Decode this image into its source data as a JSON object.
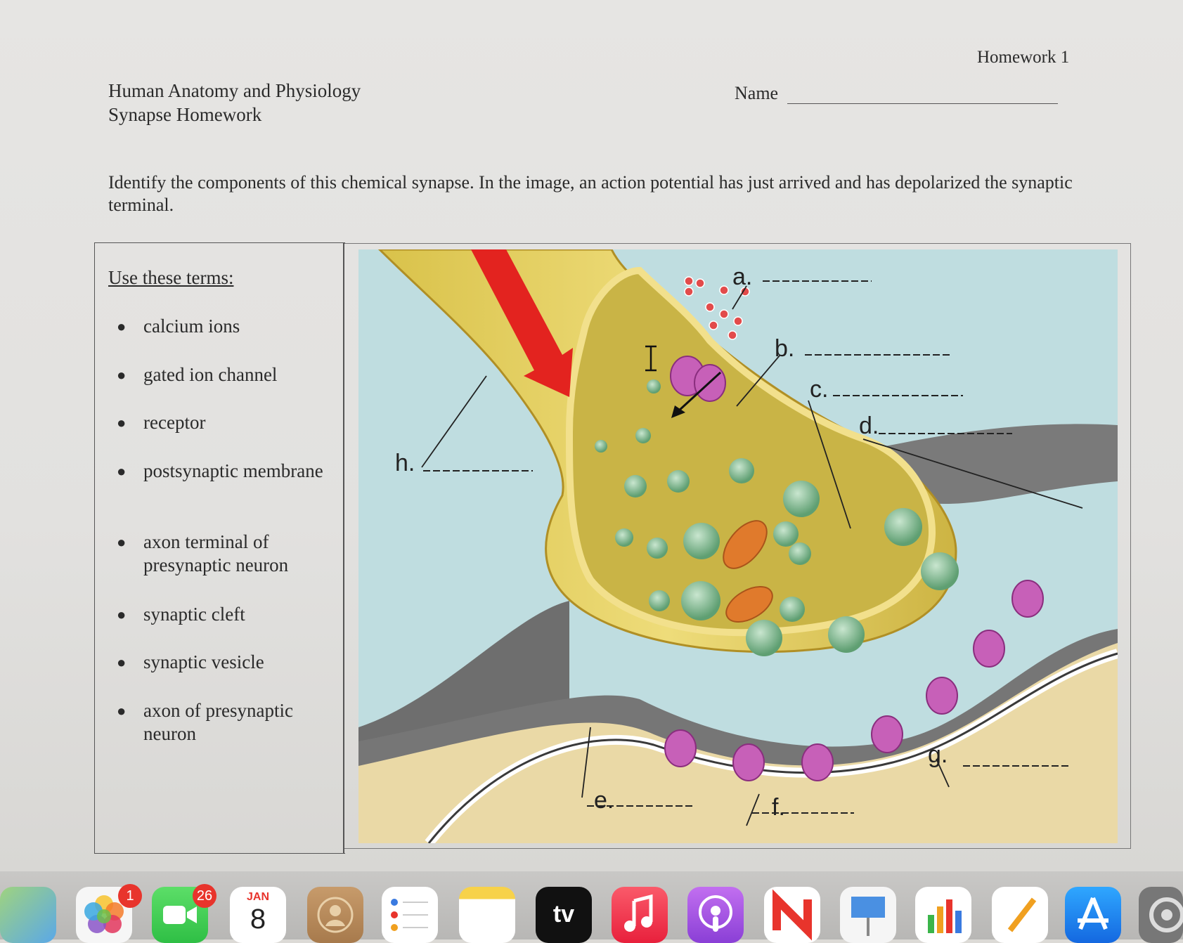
{
  "header": {
    "homework_label": "Homework 1",
    "course_title": "Human Anatomy and Physiology",
    "course_subtitle": "Synapse Homework",
    "name_label": "Name"
  },
  "instructions": "Identify the components of this chemical synapse. In the image, an action potential has just arrived and has depolarized the synaptic terminal.",
  "terms": {
    "heading": "Use these terms:",
    "items": [
      "calcium ions",
      "gated ion channel",
      "receptor",
      "postsynaptic membrane",
      "axon terminal of presynaptic neuron",
      "synaptic cleft",
      "synaptic vesicle",
      "axon of presynaptic neuron"
    ]
  },
  "diagram_labels": {
    "a": "a.",
    "b": "b.",
    "c": "c.",
    "d": "d.",
    "e": "e.",
    "f": "f.",
    "g": "g.",
    "h": "h."
  },
  "dock": {
    "photos_badge": "1",
    "facetime_badge": "26",
    "calendar_month": "JAN",
    "calendar_day": "8",
    "tv_label": "tv",
    "apps": [
      "maps",
      "photos",
      "facetime",
      "calendar",
      "contacts",
      "reminders",
      "notes",
      "apple-tv",
      "music",
      "podcasts",
      "news",
      "keynote",
      "numbers",
      "pages",
      "app-store",
      "system-settings"
    ]
  },
  "colors": {
    "page_bg": "#e4e3e1",
    "diagram_bg": "#bfdde0",
    "axon_fill": "#e2cf5a",
    "arrow_red": "#e3231f",
    "receptor_pink": "#c760b8",
    "vesicle_green": "#8cc29a",
    "cleft_gray": "#6f6f6f",
    "postsynaptic_tan": "#ead9a6"
  }
}
